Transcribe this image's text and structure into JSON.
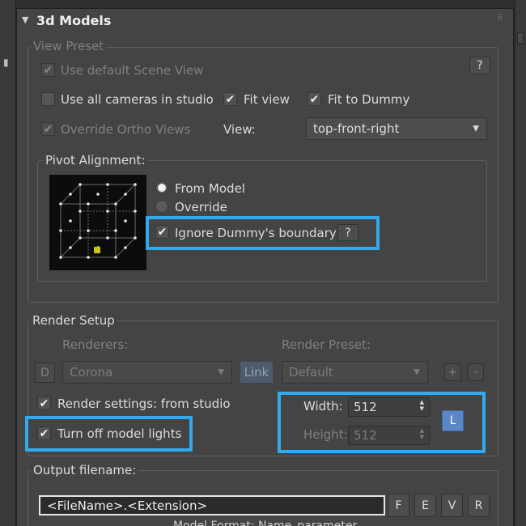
{
  "rollout": {
    "title": "3d Models",
    "arrow_icon": "triangle-down-icon",
    "grip_icon": "grip-dots-icon"
  },
  "view_preset": {
    "label": "View Preset",
    "use_default_scene_view": {
      "label": "Use default Scene View",
      "checked": true,
      "enabled": false
    },
    "help_label": "?",
    "use_all_cameras": {
      "label": "Use all cameras in studio",
      "checked": false
    },
    "fit_view": {
      "label": "Fit view",
      "checked": true
    },
    "fit_to_dummy": {
      "label": "Fit to Dummy",
      "checked": true
    },
    "override_ortho": {
      "label": "Override Ortho Views",
      "checked": true,
      "enabled": false
    },
    "view_label": "View:",
    "view_value": "top-front-right"
  },
  "pivot_alignment": {
    "label": "Pivot Alignment:",
    "options": [
      {
        "label": "From Model",
        "selected": true
      },
      {
        "label": "Override",
        "selected": false
      }
    ],
    "ignore_dummy": {
      "label": "Ignore Dummy's boundary",
      "checked": true
    },
    "help_label": "?"
  },
  "render_setup": {
    "label": "Render Setup",
    "renderers_label": "Renderers:",
    "render_preset_label": "Render Preset:",
    "d_button": "D",
    "renderer_value": "Corona",
    "link_button": "Link",
    "preset_value": "Default",
    "plus_button": "+",
    "minus_button": "-",
    "render_settings": {
      "label": "Render settings: from studio",
      "checked": true
    },
    "turn_off_lights": {
      "label": "Turn off model lights",
      "checked": true
    },
    "width_label": "Width:",
    "width_value": "512",
    "height_label": "Height:",
    "height_value": "512",
    "lock_button": "L"
  },
  "output": {
    "label": "Output filename:",
    "filename_value": "<FileName>.<Extension>",
    "buttons": [
      "F",
      "E",
      "V",
      "R"
    ],
    "cut_text": "Model Format: Name_parameter"
  },
  "colors": {
    "highlight": "#33a9ee",
    "accent_blue": "#5b87c7",
    "panel_bg": "#444444"
  }
}
